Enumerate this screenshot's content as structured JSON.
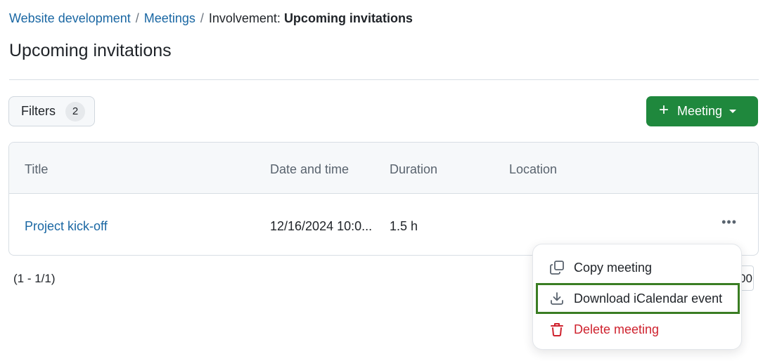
{
  "breadcrumb": {
    "items": [
      "Website development",
      "Meetings"
    ],
    "separator": "/",
    "current_prefix": "Involvement:",
    "current": "Upcoming invitations"
  },
  "page": {
    "title": "Upcoming invitations"
  },
  "toolbar": {
    "filters_label": "Filters",
    "filters_count": "2",
    "meeting_button_label": "Meeting",
    "meeting_button_color": "#1f883d"
  },
  "table": {
    "columns": [
      "Title",
      "Date and time",
      "Duration",
      "Location"
    ],
    "rows": [
      {
        "title": "Project kick-off",
        "date_time": "12/16/2024 10:0...",
        "duration": "1.5 h",
        "location": ""
      }
    ],
    "more_actions_label": "..."
  },
  "pagination": {
    "range_text": "(1 - 1/1)",
    "per_page_partial": "00"
  },
  "context_menu": {
    "items": [
      {
        "label": "Copy meeting",
        "icon": "copy-icon"
      },
      {
        "label": "Download iCalendar event",
        "icon": "download-icon",
        "highlighted": true
      },
      {
        "label": "Delete meeting",
        "icon": "trash-icon",
        "danger": true
      }
    ],
    "highlight_color": "#3a7d23",
    "danger_color": "#cf222e"
  }
}
